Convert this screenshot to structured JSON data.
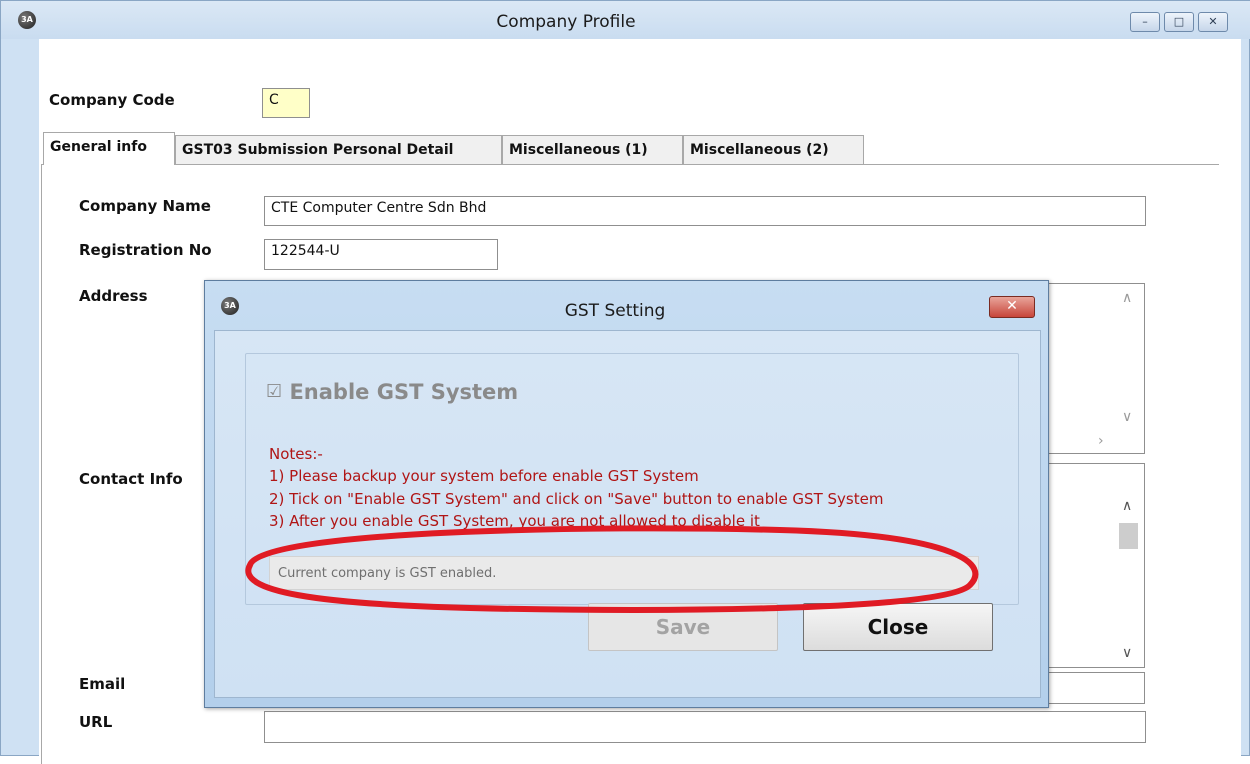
{
  "window": {
    "title": "Company Profile",
    "icon_text": "3A",
    "controls": {
      "minimize": "–",
      "maximize": "□",
      "close": "✕"
    }
  },
  "company_code": {
    "label": "Company Code",
    "value": "C"
  },
  "tabs": [
    {
      "label": "General info",
      "active": true
    },
    {
      "label": "GST03 Submission Personal Detail",
      "active": false
    },
    {
      "label": "Miscellaneous (1)",
      "active": false
    },
    {
      "label": "Miscellaneous (2)",
      "active": false
    }
  ],
  "general": {
    "company_name_label": "Company Name",
    "company_name_value": "CTE Computer Centre Sdn Bhd",
    "registration_label": "Registration No",
    "registration_value": "122544-U",
    "address_label": "Address",
    "contact_label": "Contact Info",
    "email_label": "Email",
    "url_label": "URL"
  },
  "dialog": {
    "title": "GST Setting",
    "icon_text": "3A",
    "close_glyph": "✕",
    "checkbox_glyph": "☑",
    "checkbox_label": "Enable GST System",
    "checkbox_checked": true,
    "notes": [
      "Notes:-",
      "1) Please backup your system before enable GST System",
      "2) Tick on \"Enable GST System\" and click on \"Save\" button to enable GST System",
      "3) After you enable GST System, you are not allowed to disable it"
    ],
    "status_text": "Current company is GST enabled.",
    "save_label": "Save",
    "close_label": "Close"
  },
  "colors": {
    "notes_text": "#b01515",
    "highlight_ellipse": "#e01b24",
    "company_code_field": "#ffffc8"
  }
}
